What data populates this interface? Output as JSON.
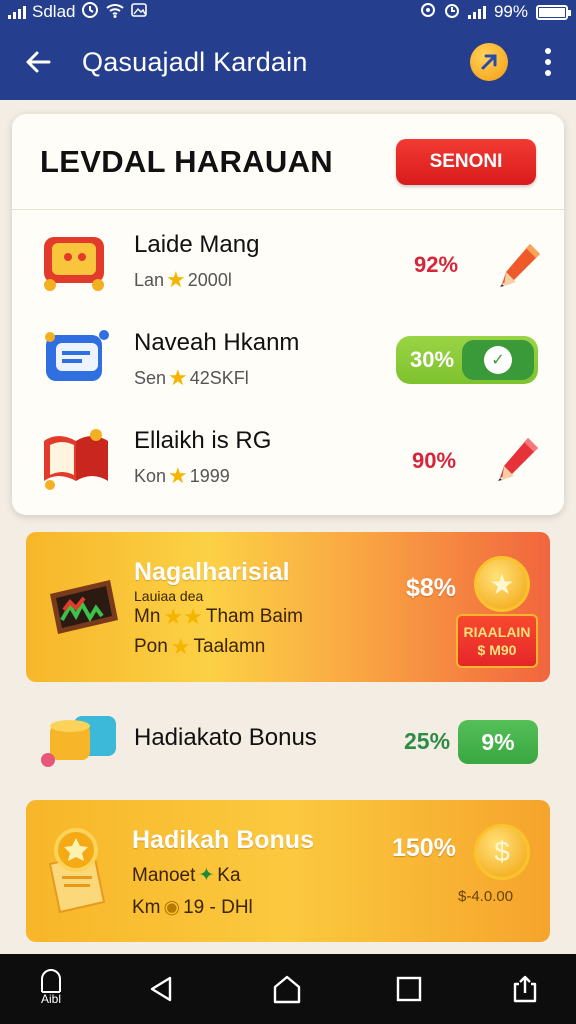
{
  "status_bar": {
    "carrier": "Sdlad",
    "battery_text": "99%",
    "battery_level": 0.99
  },
  "app_bar": {
    "title": "Qasuajadl Kardain",
    "icons": [
      "back-arrow-icon",
      "coin-icon",
      "more-vert-icon"
    ]
  },
  "main_card": {
    "title": "LEVDAL HARAUAN",
    "button_label": "SENONI",
    "rows": [
      {
        "name": "Laide Mang",
        "sub_prefix": "Lan",
        "sub_value": "2000l",
        "value": "92%",
        "action_icon": "pencil-icon"
      },
      {
        "name": "Naveah Hkanm",
        "sub_prefix": "Sen",
        "sub_value": "42SKFl",
        "value": "30%",
        "action_icon": "toggle-check-icon"
      },
      {
        "name": "Ellaikh is RG",
        "sub_prefix": "Kon",
        "sub_value": "1999",
        "value": "90%",
        "action_icon": "pencil-icon"
      }
    ]
  },
  "promo_1": {
    "title": "Nagalharisial",
    "line_1": "Lauiaa dea",
    "line_2_prefix": "Mn",
    "line_2_text": "Tham Baim",
    "line_3_prefix": "Pon",
    "line_3_text": "Taalamn",
    "value": "$8%",
    "badge_line_1": "RIAALAIN",
    "badge_line_2": "$ M90"
  },
  "hadiah_row": {
    "name": "Hadiakato Bonus",
    "value": "25%",
    "button_label": "9%"
  },
  "promo_2": {
    "title": "Hadikah Bonus",
    "line_1_prefix": "Manoet",
    "line_1_text": "Ka",
    "line_2_prefix": "Km",
    "line_2_text": "19 - DHl",
    "value": "150%",
    "footer_text": "$-4.0.00"
  },
  "nav_bar": {
    "home_label": "Aibl"
  },
  "colors": {
    "primary": "#253f8e",
    "danger": "#d91b1b",
    "success": "#3aa640",
    "accent": "#f8b629"
  }
}
